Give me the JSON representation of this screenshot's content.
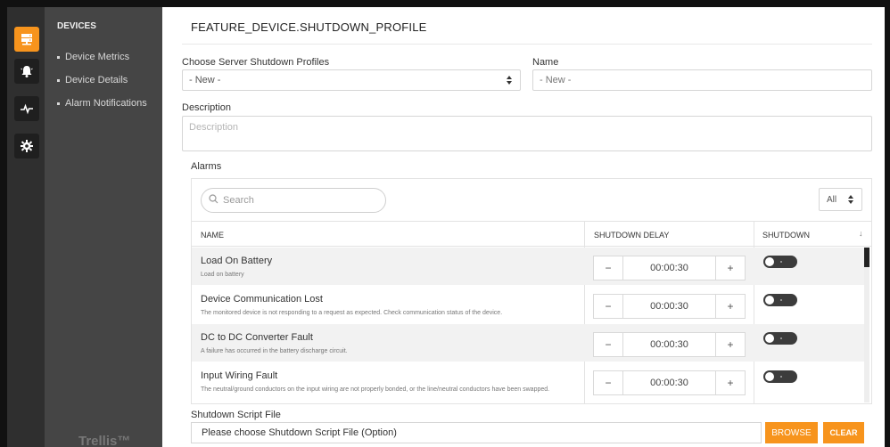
{
  "nav": {
    "section_title": "DEVICES",
    "items": [
      {
        "label": "Device Metrics"
      },
      {
        "label": "Device Details"
      },
      {
        "label": "Alarm Notifications"
      }
    ],
    "brand": "Trellis™"
  },
  "rail": {
    "icons": [
      "server-icon",
      "bell-icon",
      "pulse-icon",
      "gear-icon"
    ],
    "accent_color": "#f7941d"
  },
  "page": {
    "title": "FEATURE_DEVICE.SHUTDOWN_PROFILE"
  },
  "form": {
    "profiles_label": "Choose Server Shutdown Profiles",
    "profiles_value": "- New -",
    "name_label": "Name",
    "name_placeholder": "- New -",
    "description_label": "Description",
    "description_placeholder": "Description"
  },
  "alarms": {
    "label": "Alarms",
    "search_placeholder": "Search",
    "filter_value": "All",
    "columns": [
      "NAME",
      "SHUTDOWN DELAY",
      "SHUTDOWN"
    ],
    "rows": [
      {
        "name": "Load On Battery",
        "description": "Load on battery",
        "delay": "00:00:30",
        "shutdown": false
      },
      {
        "name": "Device Communication Lost",
        "description": "The monitored device is not responding to a request as expected. Check communication status of the device.",
        "delay": "00:00:30",
        "shutdown": false
      },
      {
        "name": "DC to DC Converter Fault",
        "description": "A failure has occurred in the battery discharge circuit.",
        "delay": "00:00:30",
        "shutdown": false
      },
      {
        "name": "Input Wiring Fault",
        "description": "The neutral/ground conductors on the input wiring are not properly bonded, or the line/neutral conductors have been swapped.",
        "delay": "00:00:30",
        "shutdown": false
      }
    ]
  },
  "script": {
    "label": "Shutdown Script File",
    "placeholder": "Please choose Shutdown Script File (Option)",
    "browse_label": "BROWSE",
    "clear_label": "CLEAR"
  }
}
